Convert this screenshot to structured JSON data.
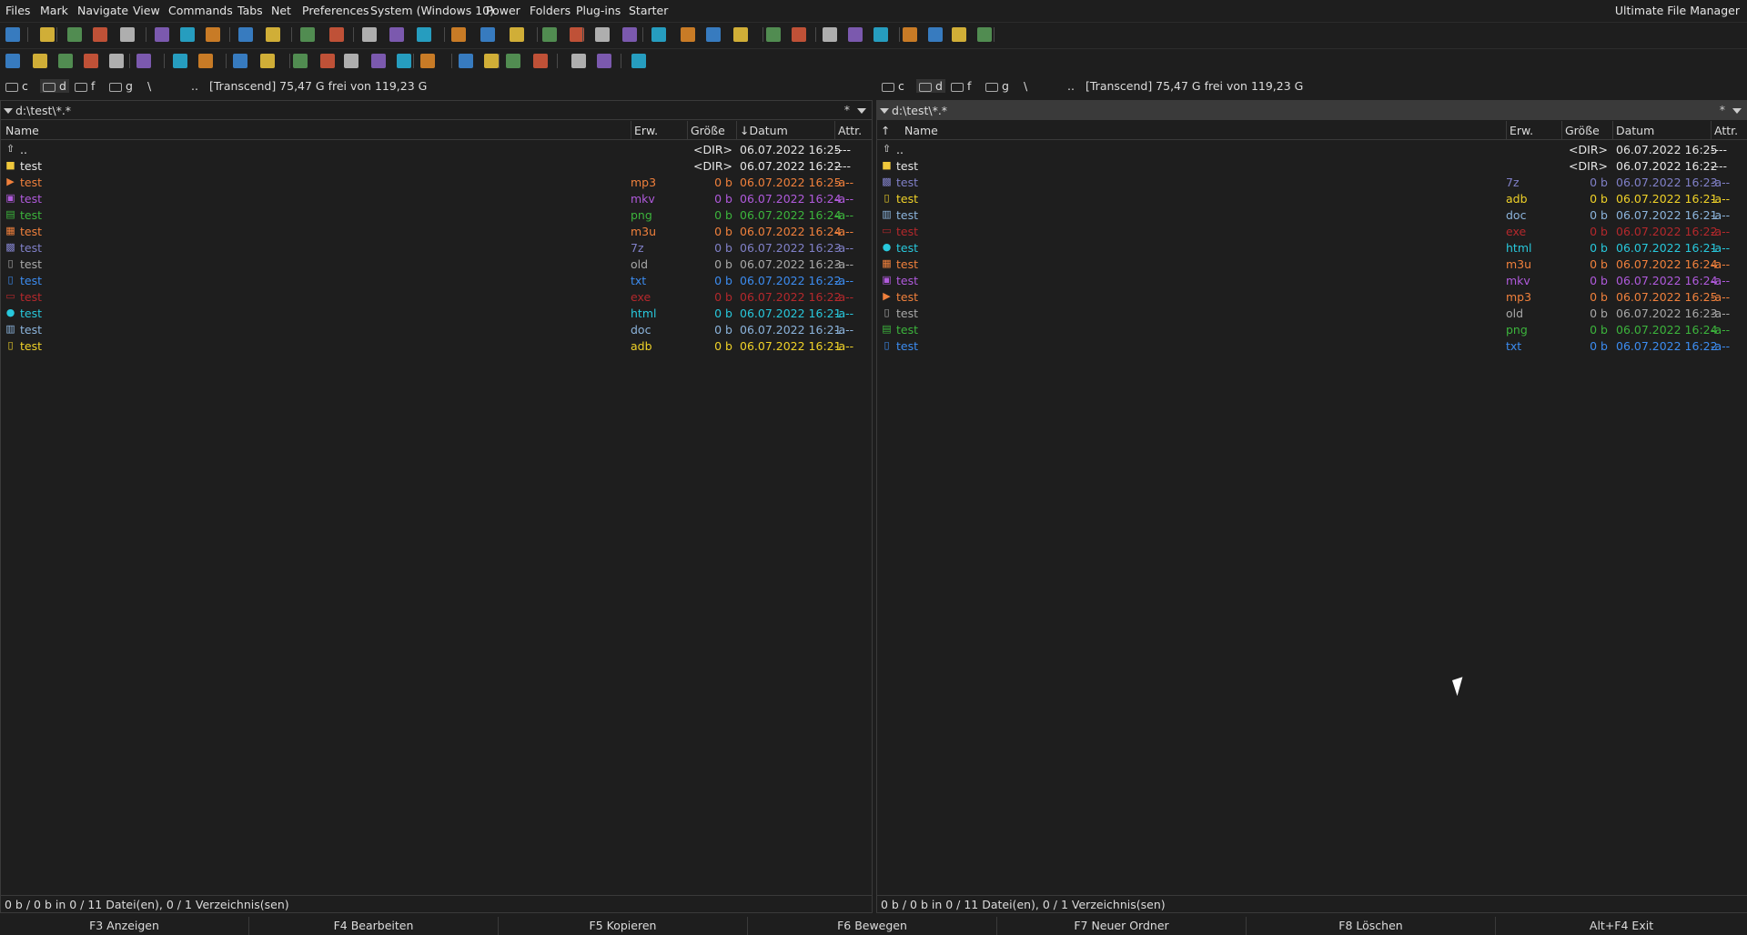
{
  "app_title": "Ultimate File Manager",
  "menu": [
    "Files",
    "Mark",
    "Navigate",
    "View",
    "Commands",
    "Tabs",
    "Net",
    "Preferences",
    "System (Windows 10)",
    "Power",
    "Folders",
    "Plug-ins",
    "Starter"
  ],
  "colors": {
    "mp3": "#f0803c",
    "mkv": "#b05adc",
    "png": "#3cb43c",
    "m3u": "#f0803c",
    "7z": "#8080c8",
    "old": "#a8a8a8",
    "txt": "#3c8cf0",
    "exe": "#b4282c",
    "html": "#28c8dc",
    "doc": "#8cb4dc",
    "adb": "#f0d228",
    "dir": "#e6e6e6"
  },
  "drives": {
    "left": {
      "items": [
        "c",
        "d",
        "f",
        "g",
        "\\",
        ".."
      ],
      "info": "[Transcend]  75,47 G frei von 119,23 G"
    },
    "right": {
      "items": [
        "c",
        "d",
        "f",
        "g",
        "\\",
        ".."
      ],
      "info": "[Transcend]  75,47 G frei von 119,23 G"
    }
  },
  "left": {
    "path": "d:\\test\\*.*",
    "star": "*",
    "headers": {
      "name": "Name",
      "ext": "Erw.",
      "size": "Größe",
      "date": "Datum",
      "attr": "Attr."
    },
    "rows": [
      {
        "name": "..",
        "ext": "",
        "size": "<DIR>",
        "date": "06.07.2022 16:25",
        "attr": "----",
        "type": "up"
      },
      {
        "name": "test",
        "ext": "",
        "size": "<DIR>",
        "date": "06.07.2022 16:22",
        "attr": "----",
        "type": "dir"
      },
      {
        "name": "test",
        "ext": "mp3",
        "size": "0 b",
        "date": "06.07.2022 16:25",
        "attr": "-a--",
        "type": "mp3"
      },
      {
        "name": "test",
        "ext": "mkv",
        "size": "0 b",
        "date": "06.07.2022 16:24",
        "attr": "-a--",
        "type": "mkv"
      },
      {
        "name": "test",
        "ext": "png",
        "size": "0 b",
        "date": "06.07.2022 16:24",
        "attr": "-a--",
        "type": "png"
      },
      {
        "name": "test",
        "ext": "m3u",
        "size": "0 b",
        "date": "06.07.2022 16:24",
        "attr": "-a--",
        "type": "m3u"
      },
      {
        "name": "test",
        "ext": "7z",
        "size": "0 b",
        "date": "06.07.2022 16:23",
        "attr": "-a--",
        "type": "7z"
      },
      {
        "name": "test",
        "ext": "old",
        "size": "0 b",
        "date": "06.07.2022 16:23",
        "attr": "-a--",
        "type": "old"
      },
      {
        "name": "test",
        "ext": "txt",
        "size": "0 b",
        "date": "06.07.2022 16:22",
        "attr": "-a--",
        "type": "txt"
      },
      {
        "name": "test",
        "ext": "exe",
        "size": "0 b",
        "date": "06.07.2022 16:22",
        "attr": "-a--",
        "type": "exe"
      },
      {
        "name": "test",
        "ext": "html",
        "size": "0 b",
        "date": "06.07.2022 16:21",
        "attr": "-a--",
        "type": "html"
      },
      {
        "name": "test",
        "ext": "doc",
        "size": "0 b",
        "date": "06.07.2022 16:21",
        "attr": "-a--",
        "type": "doc"
      },
      {
        "name": "test",
        "ext": "adb",
        "size": "0 b",
        "date": "06.07.2022 16:21",
        "attr": "-a--",
        "type": "adb"
      }
    ],
    "status": "0 b / 0 b in 0 / 11 Datei(en), 0 / 1 Verzeichnis(sen)"
  },
  "right": {
    "path": "d:\\test\\*.*",
    "star": "*",
    "headers": {
      "name": "Name",
      "ext": "Erw.",
      "size": "Größe",
      "date": "Datum",
      "attr": "Attr."
    },
    "rows": [
      {
        "name": "..",
        "ext": "",
        "size": "<DIR>",
        "date": "06.07.2022 16:25",
        "attr": "----",
        "type": "up"
      },
      {
        "name": "test",
        "ext": "",
        "size": "<DIR>",
        "date": "06.07.2022 16:22",
        "attr": "----",
        "type": "dir"
      },
      {
        "name": "test",
        "ext": "7z",
        "size": "0 b",
        "date": "06.07.2022 16:23",
        "attr": "-a--",
        "type": "7z"
      },
      {
        "name": "test",
        "ext": "adb",
        "size": "0 b",
        "date": "06.07.2022 16:21",
        "attr": "-a--",
        "type": "adb"
      },
      {
        "name": "test",
        "ext": "doc",
        "size": "0 b",
        "date": "06.07.2022 16:21",
        "attr": "-a--",
        "type": "doc"
      },
      {
        "name": "test",
        "ext": "exe",
        "size": "0 b",
        "date": "06.07.2022 16:22",
        "attr": "-a--",
        "type": "exe"
      },
      {
        "name": "test",
        "ext": "html",
        "size": "0 b",
        "date": "06.07.2022 16:21",
        "attr": "-a--",
        "type": "html"
      },
      {
        "name": "test",
        "ext": "m3u",
        "size": "0 b",
        "date": "06.07.2022 16:24",
        "attr": "-a--",
        "type": "m3u"
      },
      {
        "name": "test",
        "ext": "mkv",
        "size": "0 b",
        "date": "06.07.2022 16:24",
        "attr": "-a--",
        "type": "mkv"
      },
      {
        "name": "test",
        "ext": "mp3",
        "size": "0 b",
        "date": "06.07.2022 16:25",
        "attr": "-a--",
        "type": "mp3"
      },
      {
        "name": "test",
        "ext": "old",
        "size": "0 b",
        "date": "06.07.2022 16:23",
        "attr": "-a--",
        "type": "old"
      },
      {
        "name": "test",
        "ext": "png",
        "size": "0 b",
        "date": "06.07.2022 16:24",
        "attr": "-a--",
        "type": "png"
      },
      {
        "name": "test",
        "ext": "txt",
        "size": "0 b",
        "date": "06.07.2022 16:22",
        "attr": "-a--",
        "type": "txt"
      }
    ],
    "status": "0 b / 0 b in 0 / 11 Datei(en), 0 / 1 Verzeichnis(sen)"
  },
  "fkeys": [
    "F3 Anzeigen",
    "F4 Bearbeiten",
    "F5 Kopieren",
    "F6 Bewegen",
    "F7 Neuer Ordner",
    "F8 Löschen",
    "Alt+F4 Exit"
  ]
}
